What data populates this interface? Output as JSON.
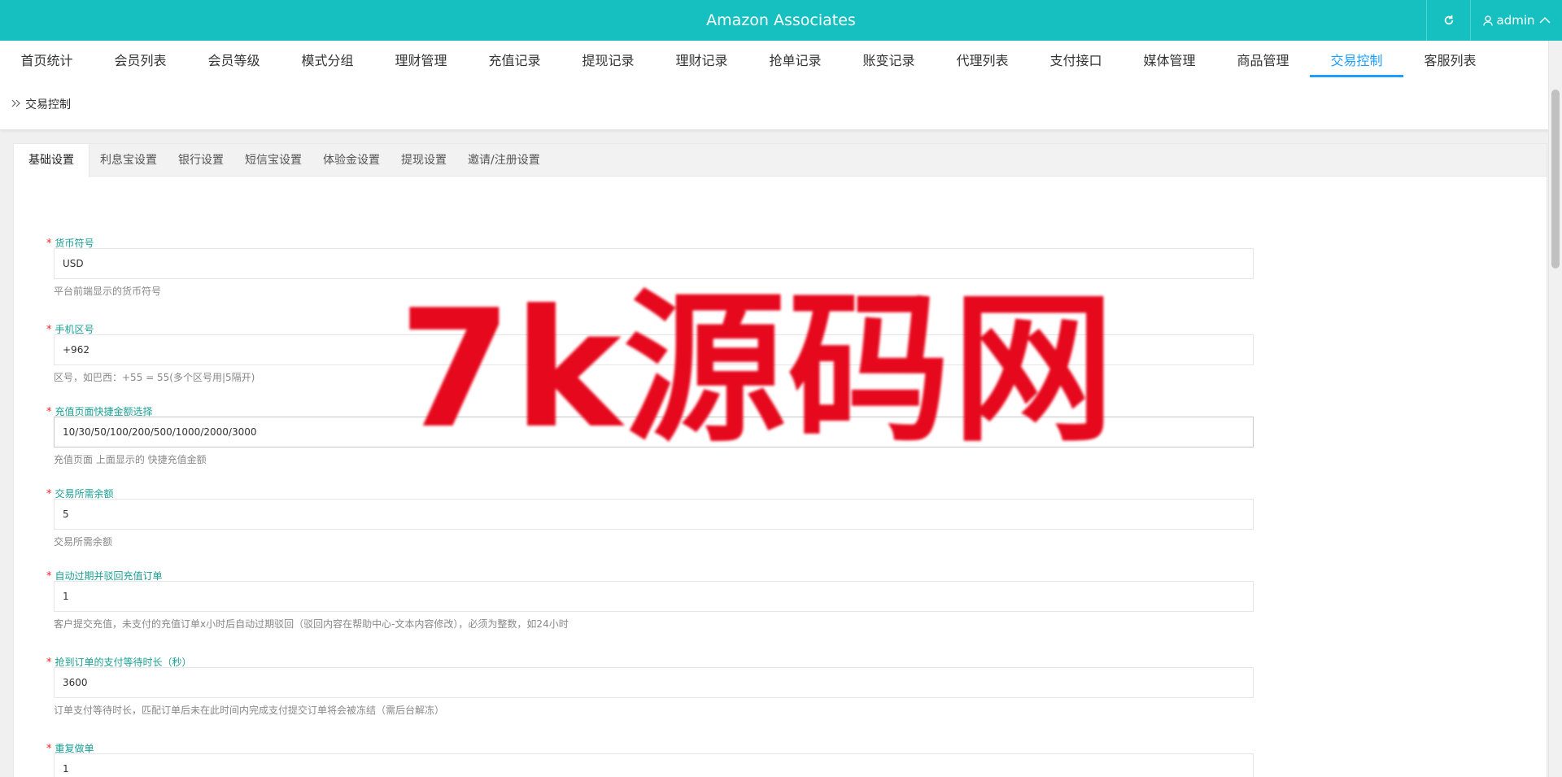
{
  "header": {
    "app_title": "Amazon Associates",
    "refresh_icon": "refresh-icon",
    "user_icon": "user-icon",
    "username": "admin",
    "chevron_icon": "chevron-up-icon",
    "bg_color": "#17c0c0"
  },
  "nav": {
    "items": [
      {
        "label": "首页统计"
      },
      {
        "label": "会员列表"
      },
      {
        "label": "会员等级"
      },
      {
        "label": "模式分组"
      },
      {
        "label": "理财管理"
      },
      {
        "label": "充值记录"
      },
      {
        "label": "提现记录"
      },
      {
        "label": "理财记录"
      },
      {
        "label": "抢单记录"
      },
      {
        "label": "账变记录"
      },
      {
        "label": "代理列表"
      },
      {
        "label": "支付接口"
      },
      {
        "label": "媒体管理"
      },
      {
        "label": "商品管理"
      },
      {
        "label": "交易控制"
      },
      {
        "label": "客服列表"
      }
    ],
    "active_index": 14,
    "active_color": "#1e9fff"
  },
  "breadcrumb": {
    "icon": "double-chevron-right-icon",
    "label": "交易控制"
  },
  "tabs": {
    "items": [
      {
        "label": "基础设置"
      },
      {
        "label": "利息宝设置"
      },
      {
        "label": "银行设置"
      },
      {
        "label": "短信宝设置"
      },
      {
        "label": "体验金设置"
      },
      {
        "label": "提现设置"
      },
      {
        "label": "邀请/注册设置"
      }
    ],
    "active_index": 0
  },
  "form": {
    "required_mark": "*",
    "fields": [
      {
        "label": "货币符号",
        "value": "USD",
        "help": "平台前端显示的货币符号"
      },
      {
        "label": "手机区号",
        "value": "+962",
        "help": "区号，如巴西：+55 = 55(多个区号用|5隔开)"
      },
      {
        "label": "充值页面快捷金额选择",
        "value": "10/30/50/100/200/500/1000/2000/3000",
        "help": "充值页面 上面显示的 快捷充值金额"
      },
      {
        "label": "交易所需余额",
        "value": "5",
        "help": "交易所需余额"
      },
      {
        "label": "自动过期并驳回充值订单",
        "value": "1",
        "help": "客户提交充值，未支付的充值订单x小时后自动过期驳回（驳回内容在帮助中心-文本内容修改），必须为整数，如24小时"
      },
      {
        "label": "抢到订单的支付等待时长（秒）",
        "value": "3600",
        "help": "订单支付等待时长，匹配订单后未在此时间内完成支付提交订单将会被冻结（需后台解冻）"
      },
      {
        "label": "重复做单",
        "value": "1",
        "help": ""
      }
    ],
    "label_color": "#1aa094",
    "required_color": "#ff2222"
  },
  "watermark": {
    "text": "7k源码网",
    "color": "#e6081d"
  }
}
